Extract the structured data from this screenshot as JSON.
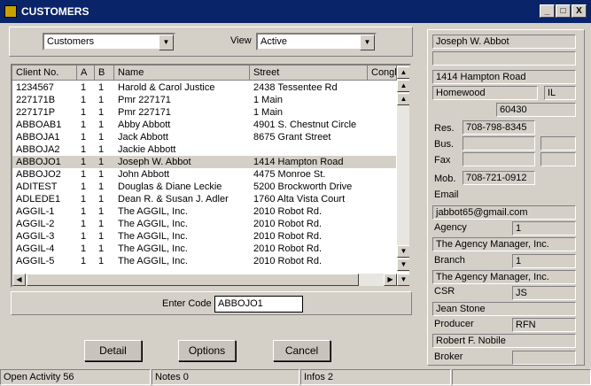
{
  "window": {
    "title": "CUSTOMERS",
    "minimize": "_",
    "maximize": "□",
    "close": "X"
  },
  "filter": {
    "type_value": "Customers",
    "view_label": "View",
    "view_value": "Active"
  },
  "columns": [
    "Client No.",
    "A",
    "B",
    "Name",
    "Street",
    "Congl"
  ],
  "rows": [
    [
      "1234567",
      "1",
      "1",
      "Harold & Carol Justice",
      "2438 Tessentee Rd"
    ],
    [
      "227171B",
      "1",
      "1",
      "Pmr 227171",
      "1 Main"
    ],
    [
      "227171P",
      "1",
      "1",
      "Pmr 227171",
      "1 Main"
    ],
    [
      "ABBOAB1",
      "1",
      "1",
      "Abby Abbott",
      "4901 S. Chestnut Circle"
    ],
    [
      "ABBOJA1",
      "1",
      "1",
      "Jack Abbott",
      "8675 Grant Street"
    ],
    [
      "ABBOJA2",
      "1",
      "1",
      "Jackie Abbott",
      ""
    ],
    [
      "ABBOJO1",
      "1",
      "1",
      "Joseph W. Abbot",
      "1414 Hampton Road"
    ],
    [
      "ABBOJO2",
      "1",
      "1",
      "John Abbott",
      "4475 Monroe St."
    ],
    [
      "ADITEST",
      "1",
      "1",
      "Douglas & Diane Leckie",
      "5200 Brockworth Drive"
    ],
    [
      "ADLEDE1",
      "1",
      "1",
      "Dean R. & Susan J. Adler",
      "1760 Alta Vista Court"
    ],
    [
      "AGGIL-1",
      "1",
      "1",
      "The AGGIL, Inc.",
      "2010 Robot Rd."
    ],
    [
      "AGGIL-2",
      "1",
      "1",
      "The AGGIL, Inc.",
      "2010 Robot Rd."
    ],
    [
      "AGGIL-3",
      "1",
      "1",
      "The AGGIL, Inc.",
      "2010 Robot Rd."
    ],
    [
      "AGGIL-4",
      "1",
      "1",
      "The AGGIL, Inc.",
      "2010 Robot Rd."
    ],
    [
      "AGGIL-5",
      "1",
      "1",
      "The AGGIL, Inc.",
      "2010 Robot Rd."
    ]
  ],
  "selected_row": 6,
  "enter_code": {
    "label": "Enter Code",
    "value": "ABBOJO1"
  },
  "buttons": {
    "detail": "Detail",
    "options": "Options",
    "cancel": "Cancel"
  },
  "detail": {
    "name": "Joseph W. Abbot",
    "name2": "",
    "address": "1414 Hampton Road",
    "city": "Homewood",
    "state": "IL",
    "zip": "60430",
    "res_label": "Res.",
    "res": "708-798-8345",
    "bus_label": "Bus.",
    "bus": "",
    "bus_ext": "",
    "fax_label": "Fax",
    "fax": "",
    "fax_ext": "",
    "mob_label": "Mob.",
    "mob": "708-721-0912",
    "email_label": "Email",
    "email": "jabbot65@gmail.com",
    "agency_label": "Agency",
    "agency_code": "1",
    "agency_name": "The Agency Manager, Inc.",
    "branch_label": "Branch",
    "branch_code": "1",
    "branch_name": "The Agency Manager, Inc.",
    "csr_label": "CSR",
    "csr_code": "JS",
    "csr_name": "Jean Stone",
    "producer_label": "Producer",
    "producer_code": "RFN",
    "producer_name": "Robert F. Nobile",
    "broker_label": "Broker",
    "broker_code": ""
  },
  "status": {
    "activity": "Open Activity 56",
    "notes": "Notes 0",
    "infos": "Infos 2"
  }
}
